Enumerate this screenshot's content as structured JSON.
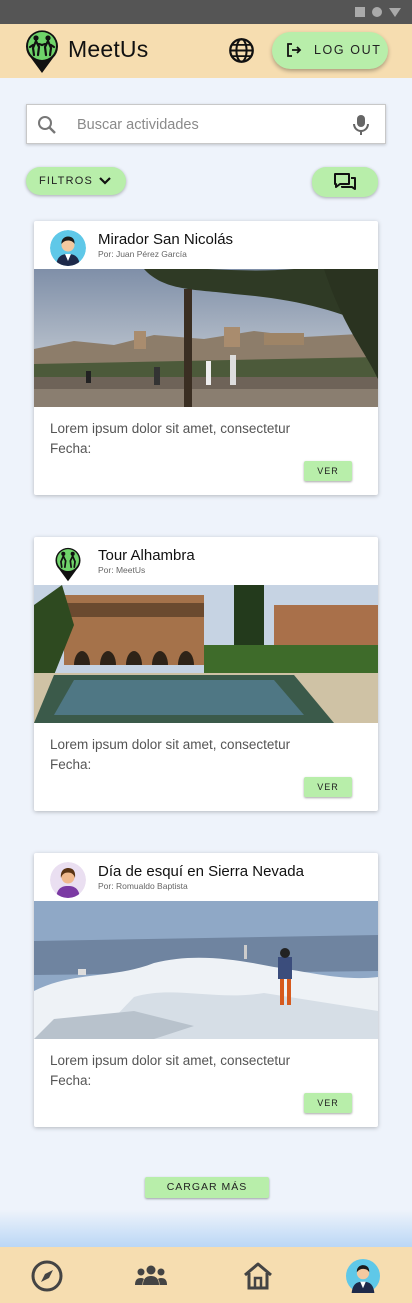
{
  "app": {
    "title": "MeetUs",
    "logout_label": "LOG OUT"
  },
  "search": {
    "placeholder": "Buscar actividades"
  },
  "filters": {
    "label": "FILTROS"
  },
  "cards": [
    {
      "title": "Mirador San Nicolás",
      "author": "Por: Juan Pérez García",
      "description": "Lorem ipsum dolor sit amet, consectetur",
      "fecha": "Fecha:",
      "button": "VER"
    },
    {
      "title": "Tour Alhambra",
      "author": "Por: MeetUs",
      "description": "Lorem ipsum dolor sit amet, consectetur",
      "fecha": "Fecha:",
      "button": "VER"
    },
    {
      "title": "Día de esquí en Sierra Nevada",
      "author": "Por: Romualdo Baptista",
      "description": "Lorem ipsum dolor sit amet, consectetur",
      "fecha": "Fecha:",
      "button": "VER"
    }
  ],
  "load_more": "CARGAR MÁS",
  "bottom_nav": [
    {
      "icon": "compass-icon"
    },
    {
      "icon": "group-icon"
    },
    {
      "icon": "home-icon"
    },
    {
      "icon": "profile-avatar"
    }
  ],
  "colors": {
    "appbar": "#f6ddb0",
    "accent_green": "#b8eeaa",
    "background": "#eef3fb"
  }
}
